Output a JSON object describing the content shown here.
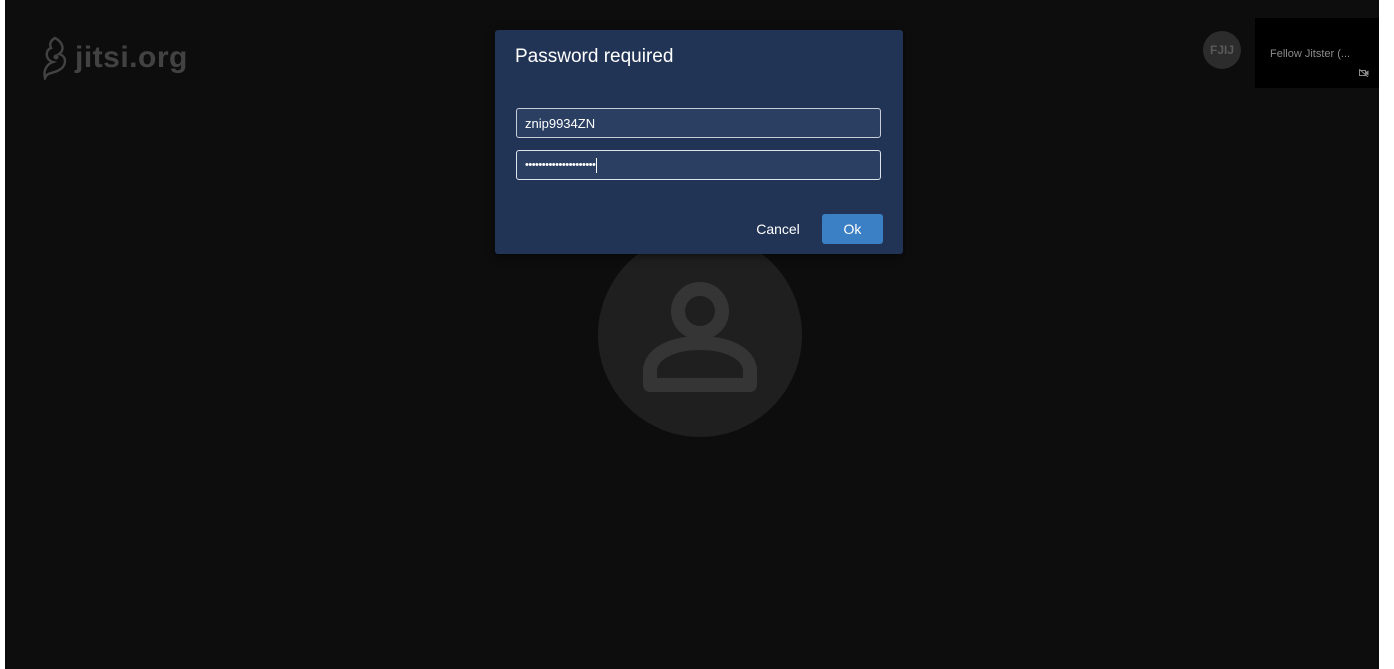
{
  "logo": {
    "text": "jitsi.org"
  },
  "remote_participant": {
    "initials": "FJIJ",
    "name": "Fellow Jitster (...",
    "camera_status_icon": "video-off-icon"
  },
  "local_participant": {
    "avatar_icon": "person-icon"
  },
  "dialog": {
    "title": "Password required",
    "username_value": "znip9934ZN",
    "password_mask": "•••••••••••••••••••••",
    "cancel_label": "Cancel",
    "ok_label": "Ok"
  },
  "colors": {
    "background": "#0d0d0d",
    "dialog_background": "#223456",
    "primary_button": "#3b7fc4"
  }
}
